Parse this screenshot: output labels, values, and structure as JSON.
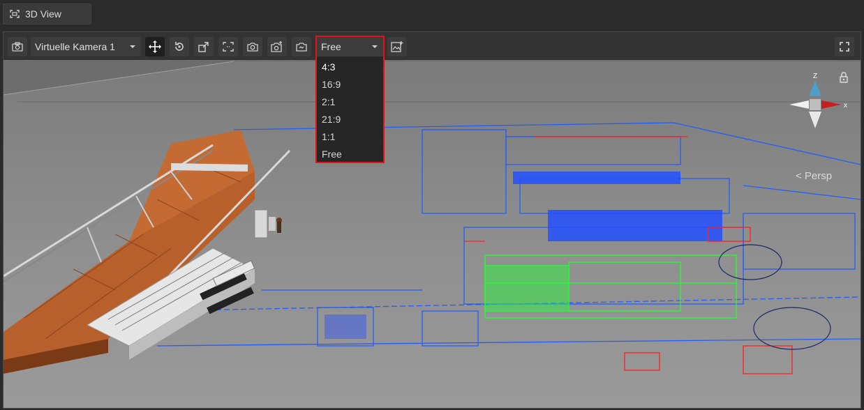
{
  "panel_tab": {
    "title": "3D View",
    "icon": "view-frame-icon"
  },
  "toolbar": {
    "camera_select": {
      "value": "Virtuelle Kamera 1"
    },
    "aspect_select": {
      "value": "Free"
    },
    "buttons": [
      {
        "name": "camera-icon"
      },
      {
        "name": "move-icon",
        "active": true
      },
      {
        "name": "orbit-icon"
      },
      {
        "name": "export-view-icon"
      },
      {
        "name": "frame-selection-icon"
      },
      {
        "name": "screenshot-icon"
      },
      {
        "name": "add-camera-icon"
      },
      {
        "name": "camera-settings-icon"
      },
      {
        "name": "add-image-icon"
      },
      {
        "name": "fullscreen-icon"
      }
    ]
  },
  "aspect_dropdown": {
    "options": [
      "4:3",
      "16:9",
      "2:1",
      "21:9",
      "1:1",
      "Free"
    ]
  },
  "gizmo": {
    "axis_y_label": "Z",
    "axis_x_label": "x",
    "projection_label": "< Persp",
    "lock_icon": "lock-icon"
  },
  "colors": {
    "highlight_border": "#e0141c",
    "floor": "#8c8c8c",
    "blueprint_blue": "#1e5cff",
    "blueprint_green": "#22ff33",
    "blueprint_red": "#ff2020",
    "wood": "#b8602c"
  }
}
